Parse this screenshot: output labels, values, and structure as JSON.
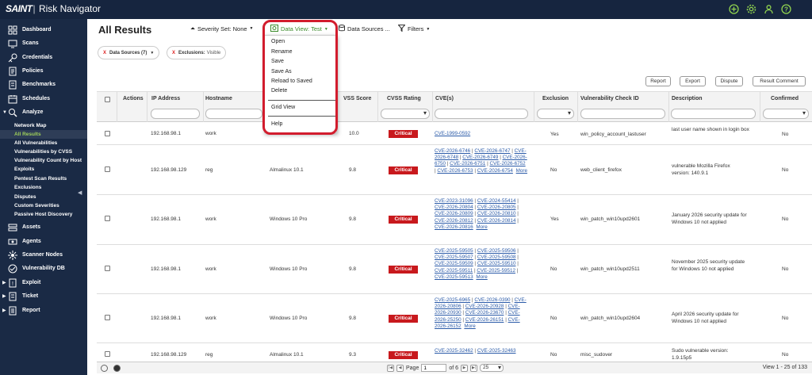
{
  "app": {
    "brand": "SAINT",
    "name": "Risk Navigator"
  },
  "top_icons": [
    "plus-icon",
    "gear-icon",
    "user-icon",
    "help-icon"
  ],
  "sidebar": {
    "items": [
      {
        "label": "Dashboard",
        "icon": "dashboard-icon"
      },
      {
        "label": "Scans",
        "icon": "scans-icon"
      },
      {
        "label": "Credentials",
        "icon": "key-icon"
      },
      {
        "label": "Policies",
        "icon": "policies-icon"
      },
      {
        "label": "Benchmarks",
        "icon": "benchmarks-icon"
      },
      {
        "label": "Schedules",
        "icon": "calendar-icon"
      },
      {
        "label": "Analyze",
        "icon": "analyze-icon"
      }
    ],
    "analyze_sub": [
      "Network Map",
      "All Results",
      "All Vulnerabilities",
      "Vulnerabilities by CVSS",
      "Vulnerability Count by Host",
      "Exploits",
      "Pentest Scan Results",
      "Exclusions",
      "Disputes",
      "Custom Severities",
      "Passive Host Discovery"
    ],
    "items2": [
      {
        "label": "Assets",
        "icon": "assets-icon"
      },
      {
        "label": "Agents",
        "icon": "agents-icon"
      },
      {
        "label": "Scanner Nodes",
        "icon": "nodes-icon"
      },
      {
        "label": "Vulnerability DB",
        "icon": "database-icon"
      },
      {
        "label": "Exploit",
        "icon": "exploit-icon"
      },
      {
        "label": "Ticket",
        "icon": "ticket-icon"
      },
      {
        "label": "Report",
        "icon": "report-icon"
      }
    ]
  },
  "header": {
    "title": "All Results",
    "severity_set": "Severity Set: None",
    "data_view": "Data View: Test",
    "data_sources": "Data Sources ...",
    "filters": "Filters"
  },
  "chips": [
    {
      "key": "Data Sources (7)",
      "value": ""
    },
    {
      "key": "Exclusions:",
      "value": "Visible"
    }
  ],
  "actions": [
    "Report",
    "Export",
    "Dispute",
    "Result Comment"
  ],
  "columns": [
    "Actions",
    "IP Address",
    "Hostname",
    "CVSS Score",
    "CVSS Rating",
    "CVE(s)",
    "Exclusion",
    "Vulnerability Check ID",
    "Description",
    "Confirmed"
  ],
  "columns_visible": {
    "cvss_score": "VSS Score"
  },
  "rows": [
    {
      "ip": "192.168.98.1",
      "host": "work",
      "os": "",
      "score": "10.0",
      "rating": "Critical",
      "cves": [
        "CVE-1999-0592"
      ],
      "more": "",
      "exclusion": "Yes",
      "check": "win_policy_account_lastuser",
      "desc": "last user name shown in login box",
      "confirmed": "No"
    },
    {
      "ip": "192.168.98.129",
      "host": "reg",
      "os": "Almalinux 10.1",
      "score": "9.8",
      "rating": "Critical",
      "cves": [
        "CVE-2026-6746",
        "CVE-2026-6747",
        "CVE-2026-6748",
        "CVE-2026-6749",
        "CVE-2026-6750",
        "CVE-2026-6751",
        "CVE-2026-6752",
        "CVE-2026-6753",
        "CVE-2026-6754"
      ],
      "more": "More",
      "exclusion": "No",
      "check": "web_client_firefox",
      "desc": "vulnerable Mozilla Firefox version: 140.9.1",
      "confirmed": "No"
    },
    {
      "ip": "192.168.98.1",
      "host": "work",
      "os": "Windows 10 Pro",
      "score": "9.8",
      "rating": "Critical",
      "cves": [
        "CVE-2023-31096",
        "CVE-2024-55414",
        "CVE-2026-20804",
        "CVE-2026-20805",
        "CVE-2026-20809",
        "CVE-2026-20810",
        "CVE-2026-20812",
        "CVE-2026-20814",
        "CVE-2026-20816"
      ],
      "more": "More",
      "exclusion": "Yes",
      "check": "win_patch_win10upd2601",
      "desc": "January 2026 security update for Windows 10 not applied",
      "confirmed": "No"
    },
    {
      "ip": "192.168.98.1",
      "host": "work",
      "os": "Windows 10 Pro",
      "score": "9.8",
      "rating": "Critical",
      "cves": [
        "CVE-2025-59505",
        "CVE-2025-59506",
        "CVE-2025-59507",
        "CVE-2025-59508",
        "CVE-2025-59509",
        "CVE-2025-59510",
        "CVE-2025-59511",
        "CVE-2025-59512",
        "CVE-2025-59513"
      ],
      "more": "More",
      "exclusion": "No",
      "check": "win_patch_win10upd2511",
      "desc": "November 2025 security update for Windows 10 not applied",
      "confirmed": "No"
    },
    {
      "ip": "192.168.98.1",
      "host": "work",
      "os": "Windows 10 Pro",
      "score": "9.8",
      "rating": "Critical",
      "cves": [
        "CVE-2025-6965",
        "CVE-2026-0390",
        "CVE-2026-20806",
        "CVE-2026-20928",
        "CVE-2026-20930",
        "CVE-2026-23670",
        "CVE-2026-25250",
        "CVE-2026-26151",
        "CVE-2026-26152"
      ],
      "more": "More",
      "exclusion": "No",
      "check": "win_patch_win10upd2604",
      "desc": "April 2026 security update for Windows 10 not applied",
      "confirmed": "No"
    },
    {
      "ip": "192.168.98.129",
      "host": "reg",
      "os": "Almalinux 10.1",
      "score": "9.3",
      "rating": "Critical",
      "cves": [
        "CVE-2025-32462",
        "CVE-2025-32463"
      ],
      "more": "",
      "exclusion": "No",
      "check": "misc_sudover",
      "desc": "Sudo vulnerable version: 1.9.15p5",
      "confirmed": "No"
    }
  ],
  "menu": {
    "group1": [
      "Open",
      "Rename",
      "Save",
      "Save As",
      "Reload to Saved",
      "Delete"
    ],
    "group2": [
      "Grid View"
    ],
    "group3": [
      "Help"
    ]
  },
  "footer": {
    "page_label": "Page",
    "page_value": "1",
    "of_pages": "of 6",
    "per_page": "25",
    "view_count": "View 1 - 25 of 133"
  },
  "colors": {
    "topbar": "#16253f",
    "sidebar": "#1a2a45",
    "active": "#9fd05a",
    "critical": "#c8191d",
    "highlight": "#d21c2d",
    "link": "#2a5aa8"
  }
}
